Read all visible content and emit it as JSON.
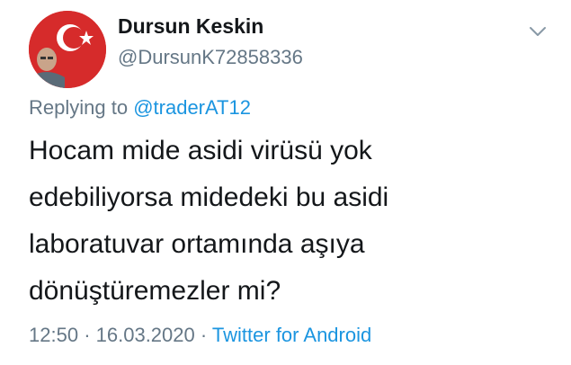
{
  "author": {
    "display_name": "Dursun Keskin",
    "handle": "@DursunK72858336"
  },
  "header": {
    "menu_icon": "chevron-down-icon"
  },
  "reply": {
    "prefix": "Replying to",
    "to_handle": "@traderAT12"
  },
  "tweet": {
    "lines": [
      "Hocam mide asidi virüsü yok",
      "edebiliyorsa midedeki bu asidi",
      "laboratuvar ortamında aşıya",
      "dönüştüremezler mi?"
    ]
  },
  "meta": {
    "time": "12:50",
    "separator": "·",
    "date": "16.03.2020",
    "source": "Twitter for Android"
  },
  "colors": {
    "text": "#14171a",
    "secondary": "#657786",
    "link": "#1b95e0",
    "avatar_bg": "#d62b2b"
  }
}
